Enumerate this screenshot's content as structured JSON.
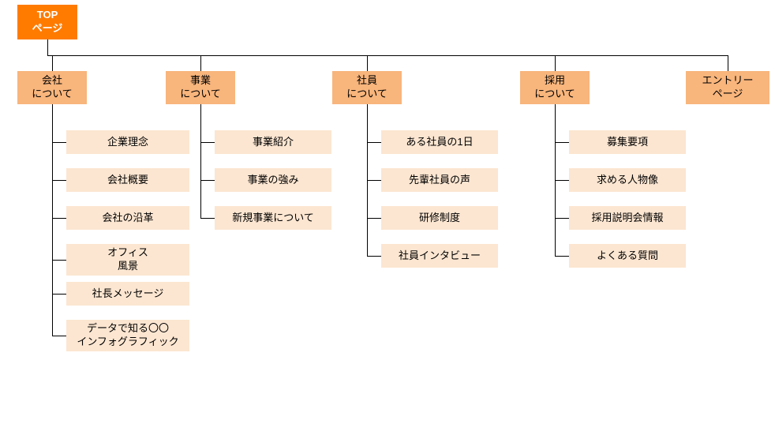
{
  "root": {
    "label": "TOP\nページ"
  },
  "columns": [
    {
      "category": "会社\nについて",
      "items": [
        "企業理念",
        "会社概要",
        "会社の沿革",
        "オフィス\n風景",
        "社長メッセージ",
        "データで知る〇〇\nインフォグラフィック"
      ]
    },
    {
      "category": "事業\nについて",
      "items": [
        "事業紹介",
        "事業の強み",
        "新規事業について"
      ]
    },
    {
      "category": "社員\nについて",
      "items": [
        "ある社員の1日",
        "先輩社員の声",
        "研修制度",
        "社員インタビュー"
      ]
    },
    {
      "category": "採用\nについて",
      "items": [
        "募集要項",
        "求める人物像",
        "採用説明会情報",
        "よくある質問"
      ]
    },
    {
      "category": "エントリー\nページ",
      "items": []
    }
  ],
  "colors": {
    "root": "#ff7b00",
    "cat": "#f8b57c",
    "item": "#fce6d1"
  }
}
